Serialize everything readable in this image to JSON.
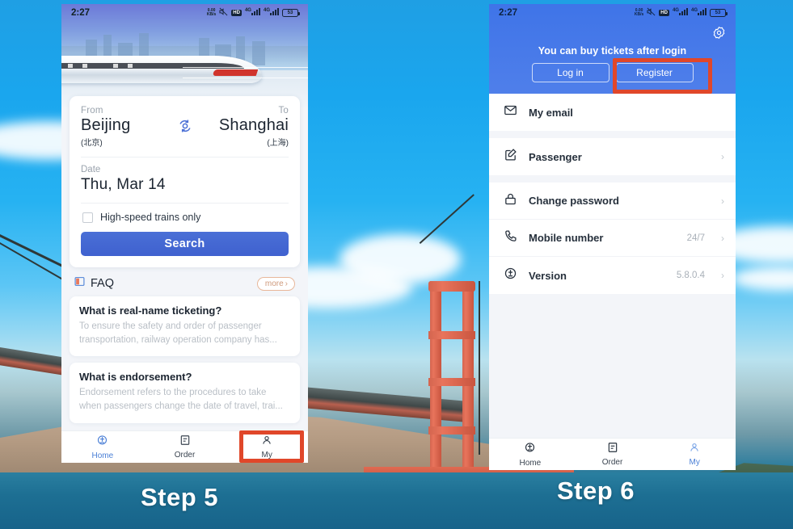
{
  "annotations": {
    "step_left": "Step 5",
    "step_right": "Step 6",
    "highlight_color": "#e0472a"
  },
  "left_phone": {
    "status_bar": {
      "time": "2:27",
      "net_speed": "0.00 KB/s",
      "mute_icon": "mute-icon",
      "hd_badge": "HD",
      "signal_1": "4G",
      "signal_2": "4G",
      "battery": "53"
    },
    "hero": {
      "image_alt": "high-speed-train-banner"
    },
    "search_card": {
      "from_label": "From",
      "from_city": "Beijing",
      "from_city_cn": "(北京)",
      "to_label": "To",
      "to_city": "Shanghai",
      "to_city_cn": "(上海)",
      "swap_icon": "swap-stations-icon",
      "date_label": "Date",
      "date_value": "Thu, Mar 14",
      "highspeed_label": "High-speed trains only",
      "highspeed_checked": false,
      "search_label": "Search"
    },
    "faq": {
      "icon": "faq-icon",
      "title": "FAQ",
      "more_label": "more",
      "items": [
        {
          "question": "What is real-name ticketing?",
          "answer": "To ensure the safety and order of passenger transportation, railway operation company has..."
        },
        {
          "question": "What is endorsement?",
          "answer": "Endorsement refers to the procedures to take when passengers change the date of travel, trai..."
        }
      ]
    },
    "tabbar": {
      "items": [
        {
          "label": "Home",
          "icon": "train-home-icon",
          "active": true
        },
        {
          "label": "Order",
          "icon": "order-list-icon",
          "active": false
        },
        {
          "label": "My",
          "icon": "person-icon",
          "active": false
        }
      ]
    }
  },
  "right_phone": {
    "status_bar": {
      "time": "2:27",
      "net_speed": "0.00 KB/s",
      "mute_icon": "mute-icon",
      "hd_badge": "HD",
      "signal_1": "4G",
      "signal_2": "4G",
      "battery": "53"
    },
    "header": {
      "gear_icon": "settings-gear-icon",
      "tip": "You can buy tickets after login",
      "login_label": "Log in",
      "register_label": "Register"
    },
    "menu": {
      "groups": [
        {
          "items": [
            {
              "icon": "envelope-icon",
              "label": "My email",
              "value": "",
              "chevron": false
            }
          ]
        },
        {
          "items": [
            {
              "icon": "passenger-edit-icon",
              "label": "Passenger",
              "value": "",
              "chevron": true
            }
          ]
        },
        {
          "items": [
            {
              "icon": "lock-icon",
              "label": "Change password",
              "value": "",
              "chevron": true
            },
            {
              "icon": "phone-icon",
              "label": "Mobile number",
              "value": "24/7",
              "chevron": true
            },
            {
              "icon": "train-icon",
              "label": "Version",
              "value": "5.8.0.4",
              "chevron": true
            }
          ]
        }
      ]
    },
    "tabbar": {
      "items": [
        {
          "label": "Home",
          "icon": "train-home-icon",
          "active": false
        },
        {
          "label": "Order",
          "icon": "order-list-icon",
          "active": false
        },
        {
          "label": "My",
          "icon": "person-icon",
          "active": true
        }
      ]
    }
  }
}
